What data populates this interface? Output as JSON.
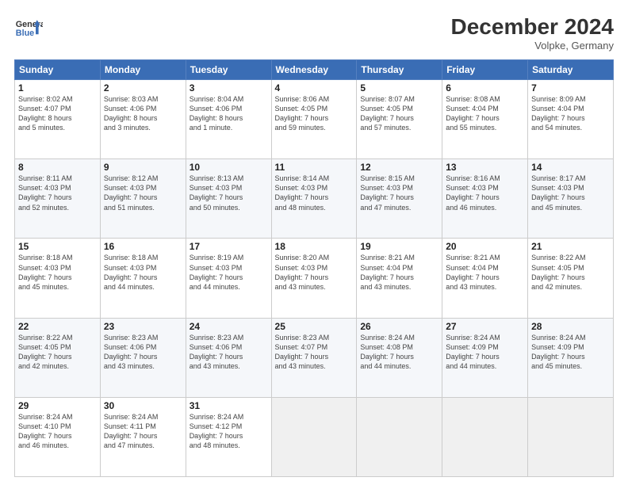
{
  "header": {
    "logo_line1": "General",
    "logo_line2": "Blue",
    "month": "December 2024",
    "location": "Volpke, Germany"
  },
  "days_of_week": [
    "Sunday",
    "Monday",
    "Tuesday",
    "Wednesday",
    "Thursday",
    "Friday",
    "Saturday"
  ],
  "weeks": [
    [
      {
        "day": "1",
        "info": "Sunrise: 8:02 AM\nSunset: 4:07 PM\nDaylight: 8 hours\nand 5 minutes."
      },
      {
        "day": "2",
        "info": "Sunrise: 8:03 AM\nSunset: 4:06 PM\nDaylight: 8 hours\nand 3 minutes."
      },
      {
        "day": "3",
        "info": "Sunrise: 8:04 AM\nSunset: 4:06 PM\nDaylight: 8 hours\nand 1 minute."
      },
      {
        "day": "4",
        "info": "Sunrise: 8:06 AM\nSunset: 4:05 PM\nDaylight: 7 hours\nand 59 minutes."
      },
      {
        "day": "5",
        "info": "Sunrise: 8:07 AM\nSunset: 4:05 PM\nDaylight: 7 hours\nand 57 minutes."
      },
      {
        "day": "6",
        "info": "Sunrise: 8:08 AM\nSunset: 4:04 PM\nDaylight: 7 hours\nand 55 minutes."
      },
      {
        "day": "7",
        "info": "Sunrise: 8:09 AM\nSunset: 4:04 PM\nDaylight: 7 hours\nand 54 minutes."
      }
    ],
    [
      {
        "day": "8",
        "info": "Sunrise: 8:11 AM\nSunset: 4:03 PM\nDaylight: 7 hours\nand 52 minutes."
      },
      {
        "day": "9",
        "info": "Sunrise: 8:12 AM\nSunset: 4:03 PM\nDaylight: 7 hours\nand 51 minutes."
      },
      {
        "day": "10",
        "info": "Sunrise: 8:13 AM\nSunset: 4:03 PM\nDaylight: 7 hours\nand 50 minutes."
      },
      {
        "day": "11",
        "info": "Sunrise: 8:14 AM\nSunset: 4:03 PM\nDaylight: 7 hours\nand 48 minutes."
      },
      {
        "day": "12",
        "info": "Sunrise: 8:15 AM\nSunset: 4:03 PM\nDaylight: 7 hours\nand 47 minutes."
      },
      {
        "day": "13",
        "info": "Sunrise: 8:16 AM\nSunset: 4:03 PM\nDaylight: 7 hours\nand 46 minutes."
      },
      {
        "day": "14",
        "info": "Sunrise: 8:17 AM\nSunset: 4:03 PM\nDaylight: 7 hours\nand 45 minutes."
      }
    ],
    [
      {
        "day": "15",
        "info": "Sunrise: 8:18 AM\nSunset: 4:03 PM\nDaylight: 7 hours\nand 45 minutes."
      },
      {
        "day": "16",
        "info": "Sunrise: 8:18 AM\nSunset: 4:03 PM\nDaylight: 7 hours\nand 44 minutes."
      },
      {
        "day": "17",
        "info": "Sunrise: 8:19 AM\nSunset: 4:03 PM\nDaylight: 7 hours\nand 44 minutes."
      },
      {
        "day": "18",
        "info": "Sunrise: 8:20 AM\nSunset: 4:03 PM\nDaylight: 7 hours\nand 43 minutes."
      },
      {
        "day": "19",
        "info": "Sunrise: 8:21 AM\nSunset: 4:04 PM\nDaylight: 7 hours\nand 43 minutes."
      },
      {
        "day": "20",
        "info": "Sunrise: 8:21 AM\nSunset: 4:04 PM\nDaylight: 7 hours\nand 43 minutes."
      },
      {
        "day": "21",
        "info": "Sunrise: 8:22 AM\nSunset: 4:05 PM\nDaylight: 7 hours\nand 42 minutes."
      }
    ],
    [
      {
        "day": "22",
        "info": "Sunrise: 8:22 AM\nSunset: 4:05 PM\nDaylight: 7 hours\nand 42 minutes."
      },
      {
        "day": "23",
        "info": "Sunrise: 8:23 AM\nSunset: 4:06 PM\nDaylight: 7 hours\nand 43 minutes."
      },
      {
        "day": "24",
        "info": "Sunrise: 8:23 AM\nSunset: 4:06 PM\nDaylight: 7 hours\nand 43 minutes."
      },
      {
        "day": "25",
        "info": "Sunrise: 8:23 AM\nSunset: 4:07 PM\nDaylight: 7 hours\nand 43 minutes."
      },
      {
        "day": "26",
        "info": "Sunrise: 8:24 AM\nSunset: 4:08 PM\nDaylight: 7 hours\nand 44 minutes."
      },
      {
        "day": "27",
        "info": "Sunrise: 8:24 AM\nSunset: 4:09 PM\nDaylight: 7 hours\nand 44 minutes."
      },
      {
        "day": "28",
        "info": "Sunrise: 8:24 AM\nSunset: 4:09 PM\nDaylight: 7 hours\nand 45 minutes."
      }
    ],
    [
      {
        "day": "29",
        "info": "Sunrise: 8:24 AM\nSunset: 4:10 PM\nDaylight: 7 hours\nand 46 minutes."
      },
      {
        "day": "30",
        "info": "Sunrise: 8:24 AM\nSunset: 4:11 PM\nDaylight: 7 hours\nand 47 minutes."
      },
      {
        "day": "31",
        "info": "Sunrise: 8:24 AM\nSunset: 4:12 PM\nDaylight: 7 hours\nand 48 minutes."
      },
      {
        "day": "",
        "info": ""
      },
      {
        "day": "",
        "info": ""
      },
      {
        "day": "",
        "info": ""
      },
      {
        "day": "",
        "info": ""
      }
    ]
  ]
}
